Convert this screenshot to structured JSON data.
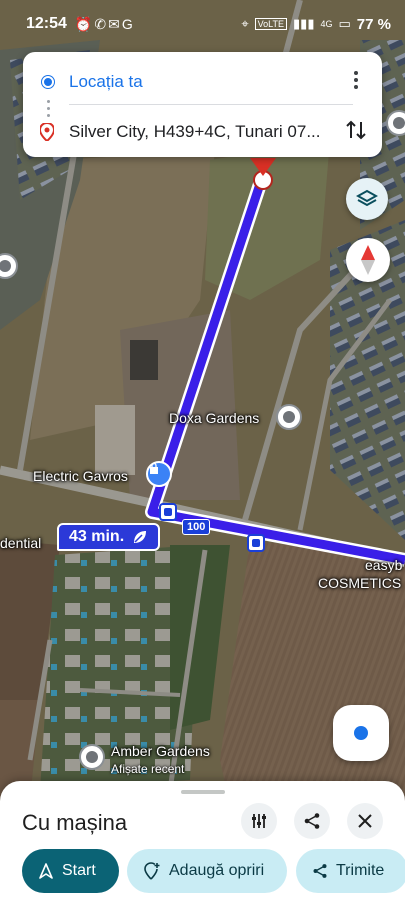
{
  "status_bar": {
    "time": "12:54",
    "battery": "77 %",
    "network": "VoLTE",
    "signal_type": "4G"
  },
  "route_card": {
    "origin": "Locația ta",
    "destination": "Silver City, H439+4C, Tunari 07..."
  },
  "map": {
    "labels": {
      "doxa": "Doxa Gardens",
      "electric": "Electric Gavros",
      "residential": "dential",
      "easy_line1": "easyb",
      "easy_line2": "COSMETICS",
      "amber": "Amber Gardens",
      "amber_sub": "Afișate recent"
    },
    "route_number": "100",
    "route_color": "#3a1fe8"
  },
  "eta": {
    "text": "43 min."
  },
  "sheet": {
    "title": "Cu mașina",
    "start_label": "Start",
    "add_stops_label": "Adaugă opriri",
    "send_label": "Trimite"
  },
  "colors": {
    "accent": "#1a73e8",
    "start_bg": "#0b6375",
    "chip_bg": "#c9ecf4"
  }
}
